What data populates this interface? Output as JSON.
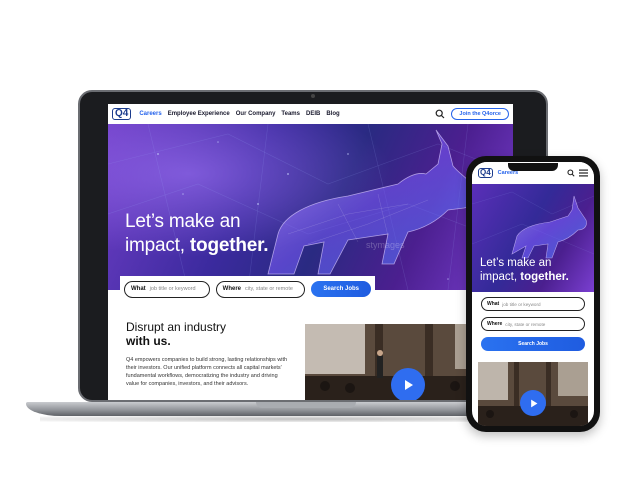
{
  "desktop": {
    "nav": {
      "logo": "Q4",
      "links": [
        "Careers",
        "Employee Experience",
        "Our Company",
        "Teams",
        "DEIB",
        "Blog"
      ],
      "active_link": "Careers",
      "cta": "Join the Q4orce"
    },
    "hero": {
      "title_line1": "Let’s make an",
      "title_line2_plain": "impact, ",
      "title_line2_bold": "together."
    },
    "search": {
      "what_label": "What",
      "what_placeholder": "job title or keyword",
      "where_label": "Where",
      "where_placeholder": "city, state or remote",
      "button": "Search Jobs"
    },
    "section": {
      "heading_line1": "Disrupt an industry",
      "heading_line2": "with us.",
      "body": "Q4 empowers companies to build strong, lasting relationships with their investors. Our unified platform connects all capital markets' fundamental workflows, democratizing the industry and driving value for companies, investors, and their advisors."
    }
  },
  "mobile": {
    "nav": {
      "logo": "Q4",
      "link": "Careers"
    },
    "hero": {
      "title_line1": "Let’s make an",
      "title_line2_plain": "impact, ",
      "title_line2_bold": "together."
    },
    "search": {
      "what_label": "What",
      "what_placeholder": "job title or keyword",
      "where_label": "Where",
      "where_placeholder": "city, state or remote",
      "button": "Search Jobs"
    }
  },
  "colors": {
    "accent": "#2563eb",
    "brand": "#1b3b8c",
    "hero_purple": "#4b1f8f"
  },
  "icons": [
    "search-icon",
    "menu-icon",
    "play-icon"
  ]
}
